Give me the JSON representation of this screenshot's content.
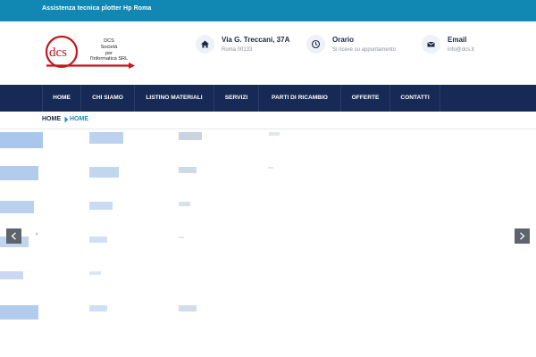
{
  "topbar": {
    "text": "Assistenza tecnica plotter Hp Roma"
  },
  "logo": {
    "mark": "dcs",
    "line1": "DCS",
    "line2": "Società",
    "line3": "per",
    "line4": "l'Informatica SRL"
  },
  "contacts": [
    {
      "icon": "home-icon",
      "title": "Via G. Treccani, 37A",
      "sub": "Roma 00133"
    },
    {
      "icon": "clock-icon",
      "title": "Orario",
      "sub": "Si riceve su appuntamento"
    },
    {
      "icon": "envelope-icon",
      "title": "Email",
      "sub": "info@dcs.it"
    }
  ],
  "nav": [
    "HOME",
    "CHI SIAMO",
    "LISTINO MATERIALI",
    "SERVIZI",
    "PARTI DI RICAMBIO",
    "OFFERTE",
    "CONTATTI"
  ],
  "breadcrumb": [
    "HOME",
    "HOME"
  ],
  "colors": {
    "topbar": "#1188b3",
    "nav": "#172a55",
    "accent": "#1a8fc2",
    "logo_red": "#c4161c"
  },
  "slider": {
    "prev_icon": "chevron-left-icon",
    "next_icon": "chevron-right-icon"
  }
}
